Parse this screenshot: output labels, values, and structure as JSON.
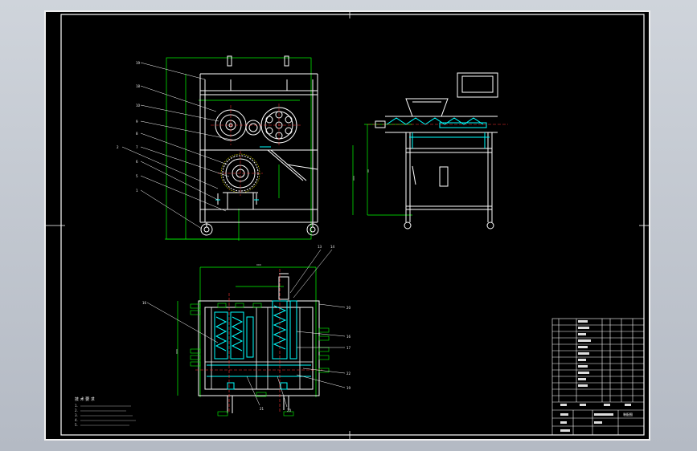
{
  "drawing": {
    "tech_req_title": "技 术 要 求",
    "tech_notes": [
      "1.",
      "2.",
      "3.",
      "4.",
      "5."
    ],
    "title_block_name": "装配图"
  },
  "colors": {
    "background": "#000000",
    "line": "#ffffff",
    "dimension": "#00ff00",
    "hatch": "#00ffff",
    "centerline": "#ff3333",
    "aux": "#ffff00"
  }
}
